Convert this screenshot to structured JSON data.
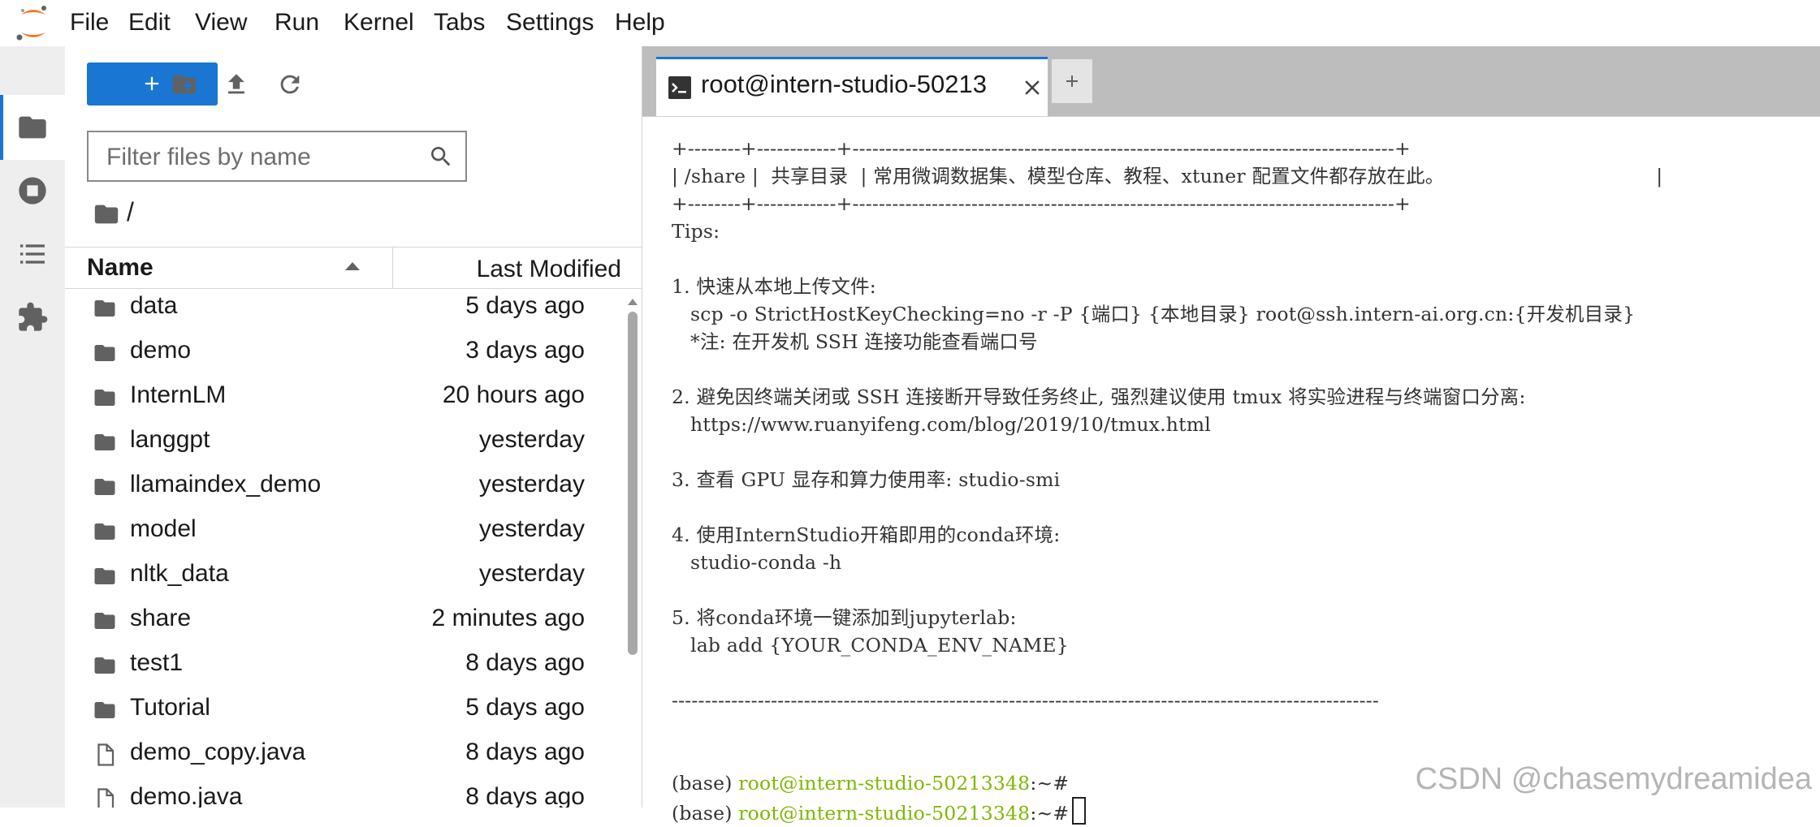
{
  "menubar": {
    "items": [
      "File",
      "Edit",
      "View",
      "Run",
      "Kernel",
      "Tabs",
      "Settings",
      "Help"
    ]
  },
  "sidebar": {
    "icons": [
      "folder-icon",
      "stop-circle-icon",
      "list-icon",
      "puzzle-icon"
    ]
  },
  "filebrowser": {
    "new_label": "+",
    "filter_placeholder": "Filter files by name",
    "breadcrumb": "/",
    "columns": {
      "name": "Name",
      "modified": "Last Modified"
    },
    "files": [
      {
        "name": "data",
        "modified": "5 days ago",
        "type": "folder"
      },
      {
        "name": "demo",
        "modified": "3 days ago",
        "type": "folder"
      },
      {
        "name": "InternLM",
        "modified": "20 hours ago",
        "type": "folder"
      },
      {
        "name": "langgpt",
        "modified": "yesterday",
        "type": "folder"
      },
      {
        "name": "llamaindex_demo",
        "modified": "yesterday",
        "type": "folder"
      },
      {
        "name": "model",
        "modified": "yesterday",
        "type": "folder"
      },
      {
        "name": "nltk_data",
        "modified": "yesterday",
        "type": "folder"
      },
      {
        "name": "share",
        "modified": "2 minutes ago",
        "type": "folder"
      },
      {
        "name": "test1",
        "modified": "8 days ago",
        "type": "folder"
      },
      {
        "name": "Tutorial",
        "modified": "5 days ago",
        "type": "folder"
      },
      {
        "name": "demo_copy.java",
        "modified": "8 days ago",
        "type": "file"
      },
      {
        "name": "demo.java",
        "modified": "8 days ago",
        "type": "file"
      }
    ]
  },
  "tabs": {
    "terminal_title": "root@intern-studio-50213",
    "terminal_icon_text": "$_"
  },
  "terminal": {
    "border_line": "+--------+------------+----------------------------------------------------------------------------------+",
    "share_row": "| /share |  共享目录  | 常用微调数据集、模型仓库、教程、xtuner 配置文件都存放在此。                                  |",
    "tips_lines": [
      "Tips:",
      "",
      "1. 快速从本地上传文件:",
      "   scp -o StrictHostKeyChecking=no -r -P {端口} {本地目录} root@ssh.intern-ai.org.cn:{开发机目录}",
      "   *注: 在开发机 SSH 连接功能查看端口号",
      "",
      "2. 避免因终端关闭或 SSH 连接断开导致任务终止, 强烈建议使用 tmux 将实验进程与终端窗口分离:",
      "   https://www.ruanyifeng.com/blog/2019/10/tmux.html",
      "",
      "3. 查看 GPU 显存和算力使用率: studio-smi",
      "",
      "4. 使用InternStudio开箱即用的conda环境:",
      "   studio-conda -h",
      "",
      "5. 将conda环境一键添加到jupyterlab:",
      "   lab add {YOUR_CONDA_ENV_NAME}",
      "",
      "-----------------------------------------------------------------------------------------------------------",
      "",
      ""
    ],
    "prompt_env": "(base) ",
    "prompt_host": "root@intern-studio-50213348",
    "prompt_tail": ":~#"
  },
  "watermark": "CSDN @chasemydreamidea",
  "colors": {
    "accent": "#1976d2",
    "prompt_green": "#7fb800"
  }
}
